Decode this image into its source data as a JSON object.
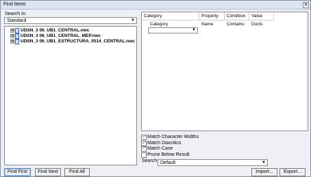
{
  "window": {
    "title": "Find Items",
    "close_label": "✕"
  },
  "left": {
    "search_in_label": "Search in:",
    "search_in_value": "Standard",
    "tree_items": [
      {
        "label": "UDSN_3 06_UB1_CENTRAL.nwc",
        "expander": "⊞"
      },
      {
        "label": "UDSN_3 06_UB1_CENTRAL_MEP.nwc",
        "expander": "⊞"
      },
      {
        "label": "UDSN_3 06_UB1_ESTRUCTURA_0514_CENTRAL.nwc",
        "expander": "⊞"
      }
    ]
  },
  "grid": {
    "headers": [
      "Category",
      "Property",
      "Condition",
      "Value"
    ],
    "row": {
      "category_placeholder": "Category",
      "property": "Name",
      "condition": "Contains",
      "value": "Ducts"
    }
  },
  "options": [
    {
      "label": "Match Character Widths",
      "checked": true,
      "mark": "✓"
    },
    {
      "label": "Match Diacritics",
      "checked": true,
      "mark": "✓"
    },
    {
      "label": "Match Case",
      "checked": true,
      "mark": "✓"
    },
    {
      "label": "Prune Below Result",
      "checked": false,
      "mark": ""
    }
  ],
  "search": {
    "label": "Search:",
    "value": "Default"
  },
  "buttons": {
    "find_first": "Find First",
    "find_next": "Find Next",
    "find_all": "Find All",
    "import": "Import...",
    "export": "Export..."
  }
}
